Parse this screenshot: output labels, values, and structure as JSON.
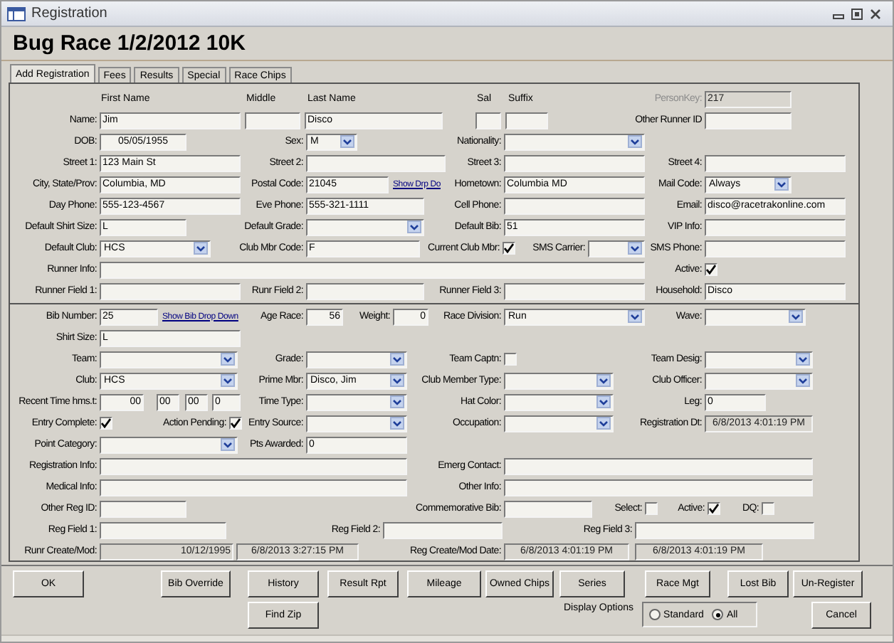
{
  "window": {
    "title": "Registration"
  },
  "heading": "Bug Race 1/2/2012 10K",
  "tabs": [
    {
      "label": "Add Registration",
      "selected": true
    },
    {
      "label": "Fees",
      "selected": false
    },
    {
      "label": "Results",
      "selected": false
    },
    {
      "label": "Special",
      "selected": false
    },
    {
      "label": "Race Chips",
      "selected": false
    }
  ],
  "upper_rows": [
    {
      "items": [
        {
          "kind": "heading",
          "text": "First Name"
        },
        {
          "kind": "heading",
          "text": "Middle"
        },
        {
          "kind": "heading",
          "text": "Last Name"
        },
        {
          "kind": "heading",
          "text": "Sal"
        },
        {
          "kind": "heading",
          "text": "Suffix"
        },
        {
          "kind": "display",
          "label": "PersonKey:",
          "value": "217"
        }
      ]
    },
    {
      "items": [
        {
          "kind": "field",
          "label": "Name:",
          "value": "Jim"
        },
        {
          "kind": "field"
        },
        {
          "kind": "field",
          "value": "Disco"
        },
        {
          "kind": "field"
        },
        {
          "kind": "field"
        },
        {
          "kind": "field",
          "label": "Other Runner ID"
        }
      ]
    },
    {
      "items": [
        {
          "kind": "field",
          "label": "DOB:",
          "value": "05/05/1955"
        },
        {
          "kind": "combo",
          "label": "Sex:",
          "value": "M"
        },
        {
          "kind": "combo",
          "label": "Nationality:"
        }
      ]
    },
    {
      "items": [
        {
          "kind": "field",
          "label": "Street 1:",
          "value": "123 Main St"
        },
        {
          "kind": "field",
          "label": "Street 2:"
        },
        {
          "kind": "field",
          "label": "Street 3:"
        },
        {
          "kind": "field",
          "label": "Street 4:"
        }
      ]
    },
    {
      "items": [
        {
          "kind": "field",
          "label": "City, State/Prov:",
          "value": "Columbia, MD"
        },
        {
          "kind": "field",
          "label": "Postal Code:",
          "value": "21045"
        },
        {
          "kind": "link",
          "text": "Show Drp Do"
        },
        {
          "kind": "field",
          "label": "Hometown:",
          "value": "Columbia MD"
        },
        {
          "kind": "combo",
          "label": "Mail Code:",
          "value": "Always"
        }
      ]
    },
    {
      "items": [
        {
          "kind": "field",
          "label": "Day Phone:",
          "value": "555-123-4567"
        },
        {
          "kind": "field",
          "label": "Eve Phone:",
          "value": "555-321-1111"
        },
        {
          "kind": "field",
          "label": "Cell Phone:"
        },
        {
          "kind": "field",
          "label": "Email:",
          "value": "disco@racetrakonline.com"
        }
      ]
    },
    {
      "items": [
        {
          "kind": "field",
          "label": "Default Shirt Size:",
          "value": "L"
        },
        {
          "kind": "combo",
          "label": "Default Grade:"
        },
        {
          "kind": "field",
          "label": "Default Bib:",
          "value": "51"
        },
        {
          "kind": "field",
          "label": "VIP Info:"
        }
      ]
    },
    {
      "items": [
        {
          "kind": "combo",
          "label": "Default Club:",
          "value": "HCS"
        },
        {
          "kind": "field",
          "label": "Club Mbr Code:",
          "value": "F"
        },
        {
          "kind": "check",
          "label": "Current Club Mbr:",
          "checked": true
        },
        {
          "kind": "combo",
          "label": "SMS Carrier:"
        },
        {
          "kind": "field",
          "label": "SMS Phone:"
        }
      ]
    },
    {
      "items": [
        {
          "kind": "field",
          "label": "Runner Info:"
        },
        {
          "kind": "check",
          "label": "Active:",
          "checked": true
        }
      ]
    },
    {
      "items": [
        {
          "kind": "field",
          "label": "Runner Field 1:"
        },
        {
          "kind": "field",
          "label": "Runr Field 2:"
        },
        {
          "kind": "field",
          "label": "Runner Field 3:"
        },
        {
          "kind": "field",
          "label": "Household:",
          "value": "Disco"
        }
      ]
    }
  ],
  "lower_rows": [
    {
      "items": [
        {
          "kind": "field",
          "label": "Bib Number:",
          "value": "25"
        },
        {
          "kind": "link",
          "text": "Show Bib Drop Down"
        },
        {
          "kind": "field",
          "label": "Age Race:",
          "value": "56"
        },
        {
          "kind": "field",
          "label": "Weight:",
          "value": "0"
        },
        {
          "kind": "combo",
          "label": "Race Division:",
          "value": "Run"
        },
        {
          "kind": "combo",
          "label": "Wave:"
        }
      ]
    },
    {
      "items": [
        {
          "kind": "field",
          "label": "Shirt Size:",
          "value": "L"
        }
      ]
    },
    {
      "items": [
        {
          "kind": "combo",
          "label": "Team:"
        },
        {
          "kind": "combo",
          "label": "Grade:"
        },
        {
          "kind": "check",
          "label": "Team Captn:",
          "checked": false
        },
        {
          "kind": "combo",
          "label": "Team Desig:"
        }
      ]
    },
    {
      "items": [
        {
          "kind": "combo",
          "label": "Club:",
          "value": "HCS"
        },
        {
          "kind": "combo",
          "label": "Prime Mbr:",
          "value": "Disco, Jim"
        },
        {
          "kind": "combo",
          "label": "Club Member Type:"
        },
        {
          "kind": "combo",
          "label": "Club Officer:"
        }
      ]
    },
    {
      "items": [
        {
          "kind": "field",
          "label": "Recent Time hms.t:",
          "value": "00"
        },
        {
          "kind": "field",
          "value": "00"
        },
        {
          "kind": "field",
          "value": "00"
        },
        {
          "kind": "field",
          "value": "0"
        },
        {
          "kind": "combo",
          "label": "Time Type:"
        },
        {
          "kind": "combo",
          "label": "Hat Color:"
        },
        {
          "kind": "field",
          "label": "Leg:",
          "value": "0"
        }
      ]
    },
    {
      "items": [
        {
          "kind": "check",
          "label": "Entry Complete:",
          "checked": true
        },
        {
          "kind": "check",
          "label": "Action Pending:",
          "checked": true
        },
        {
          "kind": "combo",
          "label": "Entry Source:"
        },
        {
          "kind": "combo",
          "label": "Occupation:"
        },
        {
          "kind": "display",
          "label": "Registration Dt:",
          "value": "6/8/2013 4:01:19 PM"
        }
      ]
    },
    {
      "items": [
        {
          "kind": "combo",
          "label": "Point Category:"
        },
        {
          "kind": "field",
          "label": "Pts Awarded:",
          "value": "0"
        }
      ]
    },
    {
      "items": [
        {
          "kind": "field",
          "label": "Registration Info:"
        },
        {
          "kind": "field",
          "label": "Emerg Contact:"
        }
      ]
    },
    {
      "items": [
        {
          "kind": "field",
          "label": "Medical Info:"
        },
        {
          "kind": "field",
          "label": "Other Info:"
        }
      ]
    },
    {
      "items": [
        {
          "kind": "field",
          "label": "Other Reg ID:"
        },
        {
          "kind": "field",
          "label": "Commemorative Bib:"
        },
        {
          "kind": "check",
          "label": "Select:",
          "checked": false
        },
        {
          "kind": "check",
          "label": "Active:",
          "checked": true
        },
        {
          "kind": "check",
          "label": "DQ:",
          "checked": false
        }
      ]
    },
    {
      "items": [
        {
          "kind": "field",
          "label": "Reg Field 1:"
        },
        {
          "kind": "field",
          "label": "Reg Field 2:"
        },
        {
          "kind": "field",
          "label": "Reg Field 3:"
        }
      ]
    },
    {
      "items": [
        {
          "kind": "display",
          "label": "Runr Create/Mod:",
          "value": "10/12/1995"
        },
        {
          "kind": "display",
          "value": "6/8/2013 3:27:15 PM"
        },
        {
          "kind": "display",
          "label": "Reg Create/Mod Date:",
          "value": "6/8/2013 4:01:19 PM"
        },
        {
          "kind": "display",
          "value": "6/8/2013 4:01:19 PM"
        }
      ]
    }
  ],
  "buttons": [
    "OK",
    "Bib Override",
    "History",
    "Result Rpt",
    "Mileage",
    "Owned Chips",
    "Series",
    "Race Mgt",
    "Lost Bib",
    "Un-Register"
  ],
  "find_zip_button": "Find Zip",
  "display_options": {
    "label": "Display Options",
    "options": [
      {
        "label": "Standard",
        "selected": false
      },
      {
        "label": "All",
        "selected": true
      }
    ]
  },
  "cancel_button": "Cancel"
}
